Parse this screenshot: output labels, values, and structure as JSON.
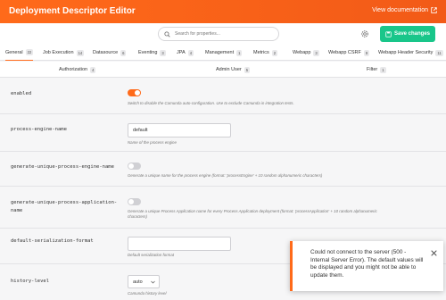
{
  "header": {
    "title": "Deployment Descriptor Editor",
    "view_doc": "View documentation"
  },
  "toolbar": {
    "search_placeholder": "Search for properties...",
    "save_label": "Save changes"
  },
  "tabs": [
    {
      "label": "General",
      "count": "22"
    },
    {
      "label": "Job Execution",
      "count": "14"
    },
    {
      "label": "Datasource",
      "count": "6"
    },
    {
      "label": "Eventing",
      "count": "3"
    },
    {
      "label": "JPA",
      "count": "4"
    },
    {
      "label": "Management",
      "count": "1"
    },
    {
      "label": "Metrics",
      "count": "2"
    },
    {
      "label": "Webapp",
      "count": "3"
    },
    {
      "label": "Webapp CSRF",
      "count": "9"
    },
    {
      "label": "Webapp Header Security",
      "count": "11"
    }
  ],
  "subtabs": [
    {
      "label": "Authorization",
      "count": "4"
    },
    {
      "label": "Admin User",
      "count": "5"
    },
    {
      "label": "Filter",
      "count": "1"
    }
  ],
  "settings": [
    {
      "name": "enabled",
      "control": "toggle",
      "state": "on",
      "description": "Switch to disable the Camunda auto-configuration. Use to exclude Camunda in integration tests."
    },
    {
      "name": "process-engine-name",
      "control": "text",
      "value": "default",
      "description": "Name of the process engine"
    },
    {
      "name": "generate-unique-process-engine-name",
      "control": "toggle",
      "state": "off",
      "description": "Generate a unique name for the process engine (format: 'processEngine' + 10 random alphanumeric characters)"
    },
    {
      "name_line1": "generate-unique-process-application-",
      "name_line2": "name",
      "control": "toggle",
      "state": "off",
      "description_line1": "Generate a unique Process Application name for every Process Application deployment (format: 'processApplication' + 10 random alphanumeric",
      "description_line2": "characters)"
    },
    {
      "name": "default-serialization-format",
      "control": "text",
      "value": "",
      "description": "Default serialization format"
    },
    {
      "name": "history-level",
      "control": "select",
      "value": "auto",
      "description": "Camunda history level"
    }
  ],
  "toast": {
    "message": "Could not connect to the server (500 - Internal Server Error). The default values will be displayed and you might not be able to update them."
  }
}
